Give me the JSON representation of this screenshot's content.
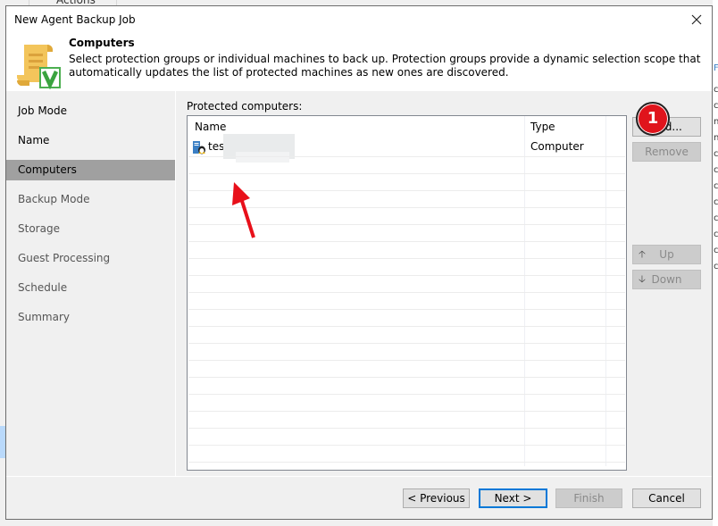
{
  "background": {
    "actions_label": "Actions"
  },
  "dialog": {
    "title": "New Agent Backup Job",
    "close_icon": "close-icon"
  },
  "header": {
    "title": "Computers",
    "description": "Select protection groups or individual machines to back up. Protection groups provide a dynamic selection scope that automatically updates the list of protected machines as new ones are discovered."
  },
  "sidebar": {
    "items": [
      {
        "label": "Job Mode",
        "state": "done"
      },
      {
        "label": "Name",
        "state": "done"
      },
      {
        "label": "Computers",
        "state": "active"
      },
      {
        "label": "Backup Mode",
        "state": "pending"
      },
      {
        "label": "Storage",
        "state": "pending"
      },
      {
        "label": "Guest Processing",
        "state": "pending"
      },
      {
        "label": "Schedule",
        "state": "pending"
      },
      {
        "label": "Summary",
        "state": "pending"
      }
    ]
  },
  "content": {
    "list_label": "Protected computers:",
    "columns": [
      "Name",
      "Type"
    ],
    "rows": [
      {
        "name": "test",
        "type": "Computer",
        "icon": "linux-computer-icon",
        "name_redacted": true
      }
    ]
  },
  "side_buttons": {
    "add": "Add...",
    "remove": "Remove",
    "up": "Up",
    "down": "Down"
  },
  "footer": {
    "previous": "< Previous",
    "next": "Next >",
    "finish": "Finish",
    "cancel": "Cancel"
  },
  "annotations": {
    "step_badge": "1",
    "badge_color": "#e0141c",
    "arrow_color": "#e8101a"
  }
}
